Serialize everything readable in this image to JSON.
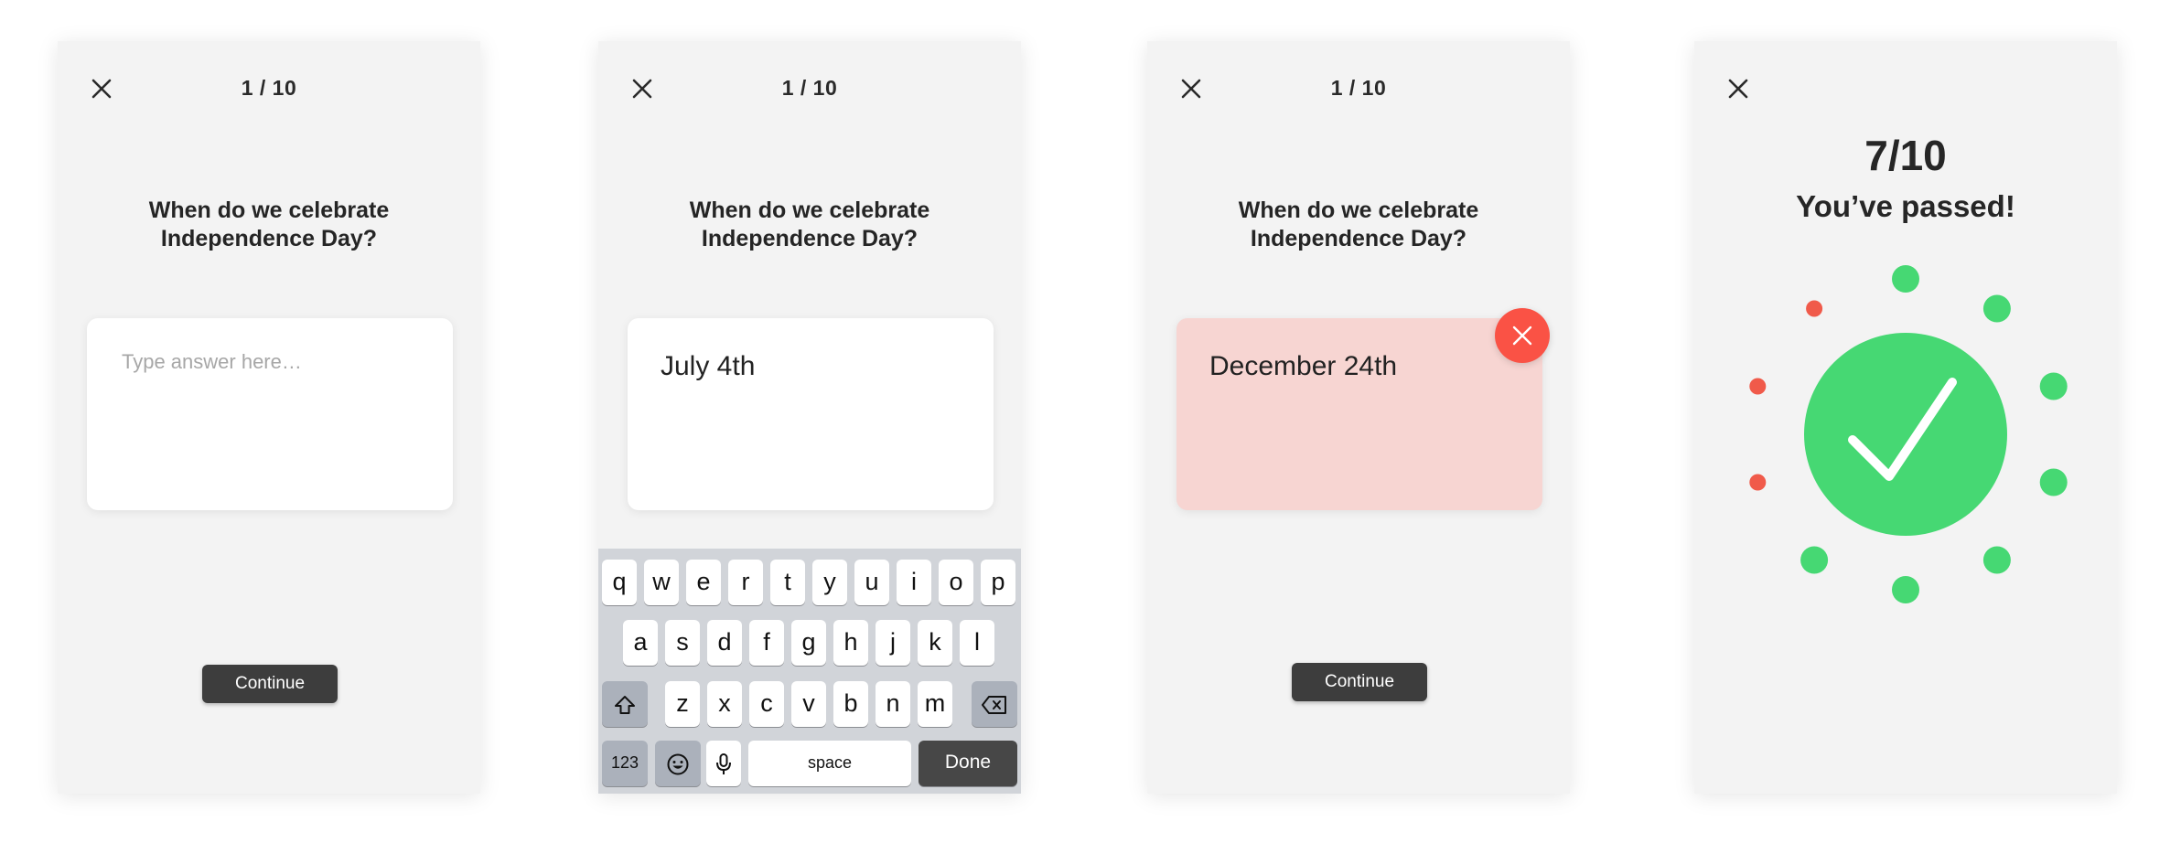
{
  "colors": {
    "screen_bg": "#f3f3f3",
    "button_dark": "#3d3d3d",
    "wrong_bg": "#f7d5d2",
    "wrong_badge": "#fa5245",
    "success_green": "#46d873",
    "miss_red": "#f05a4a",
    "keyboard_bg": "#d1d4d9"
  },
  "screens": {
    "s1": {
      "counter": "1 / 10",
      "question": "When do we celebrate Independence Day?",
      "answer_placeholder": "Type answer here…",
      "continue_label": "Continue"
    },
    "s2": {
      "counter": "1 / 10",
      "question": "When do we celebrate Independence Day?",
      "answer_value": "July 4th"
    },
    "s3": {
      "counter": "1 / 10",
      "question": "When do we celebrate Independence Day?",
      "answer_value": "December 24th",
      "continue_label": "Continue"
    },
    "s4": {
      "score": "7/10",
      "message": "You’ve passed!",
      "correct_count": 7,
      "wrong_count": 3,
      "total": 10
    }
  },
  "keyboard": {
    "row1": [
      "q",
      "w",
      "e",
      "r",
      "t",
      "y",
      "u",
      "i",
      "o",
      "p"
    ],
    "row2": [
      "a",
      "s",
      "d",
      "f",
      "g",
      "h",
      "j",
      "k",
      "l"
    ],
    "row3": [
      "z",
      "x",
      "c",
      "v",
      "b",
      "n",
      "m"
    ],
    "numbers_label": "123",
    "space_label": "space",
    "done_label": "Done",
    "icons": [
      "shift-icon",
      "backspace-icon",
      "emoji-icon",
      "microphone-icon"
    ]
  }
}
